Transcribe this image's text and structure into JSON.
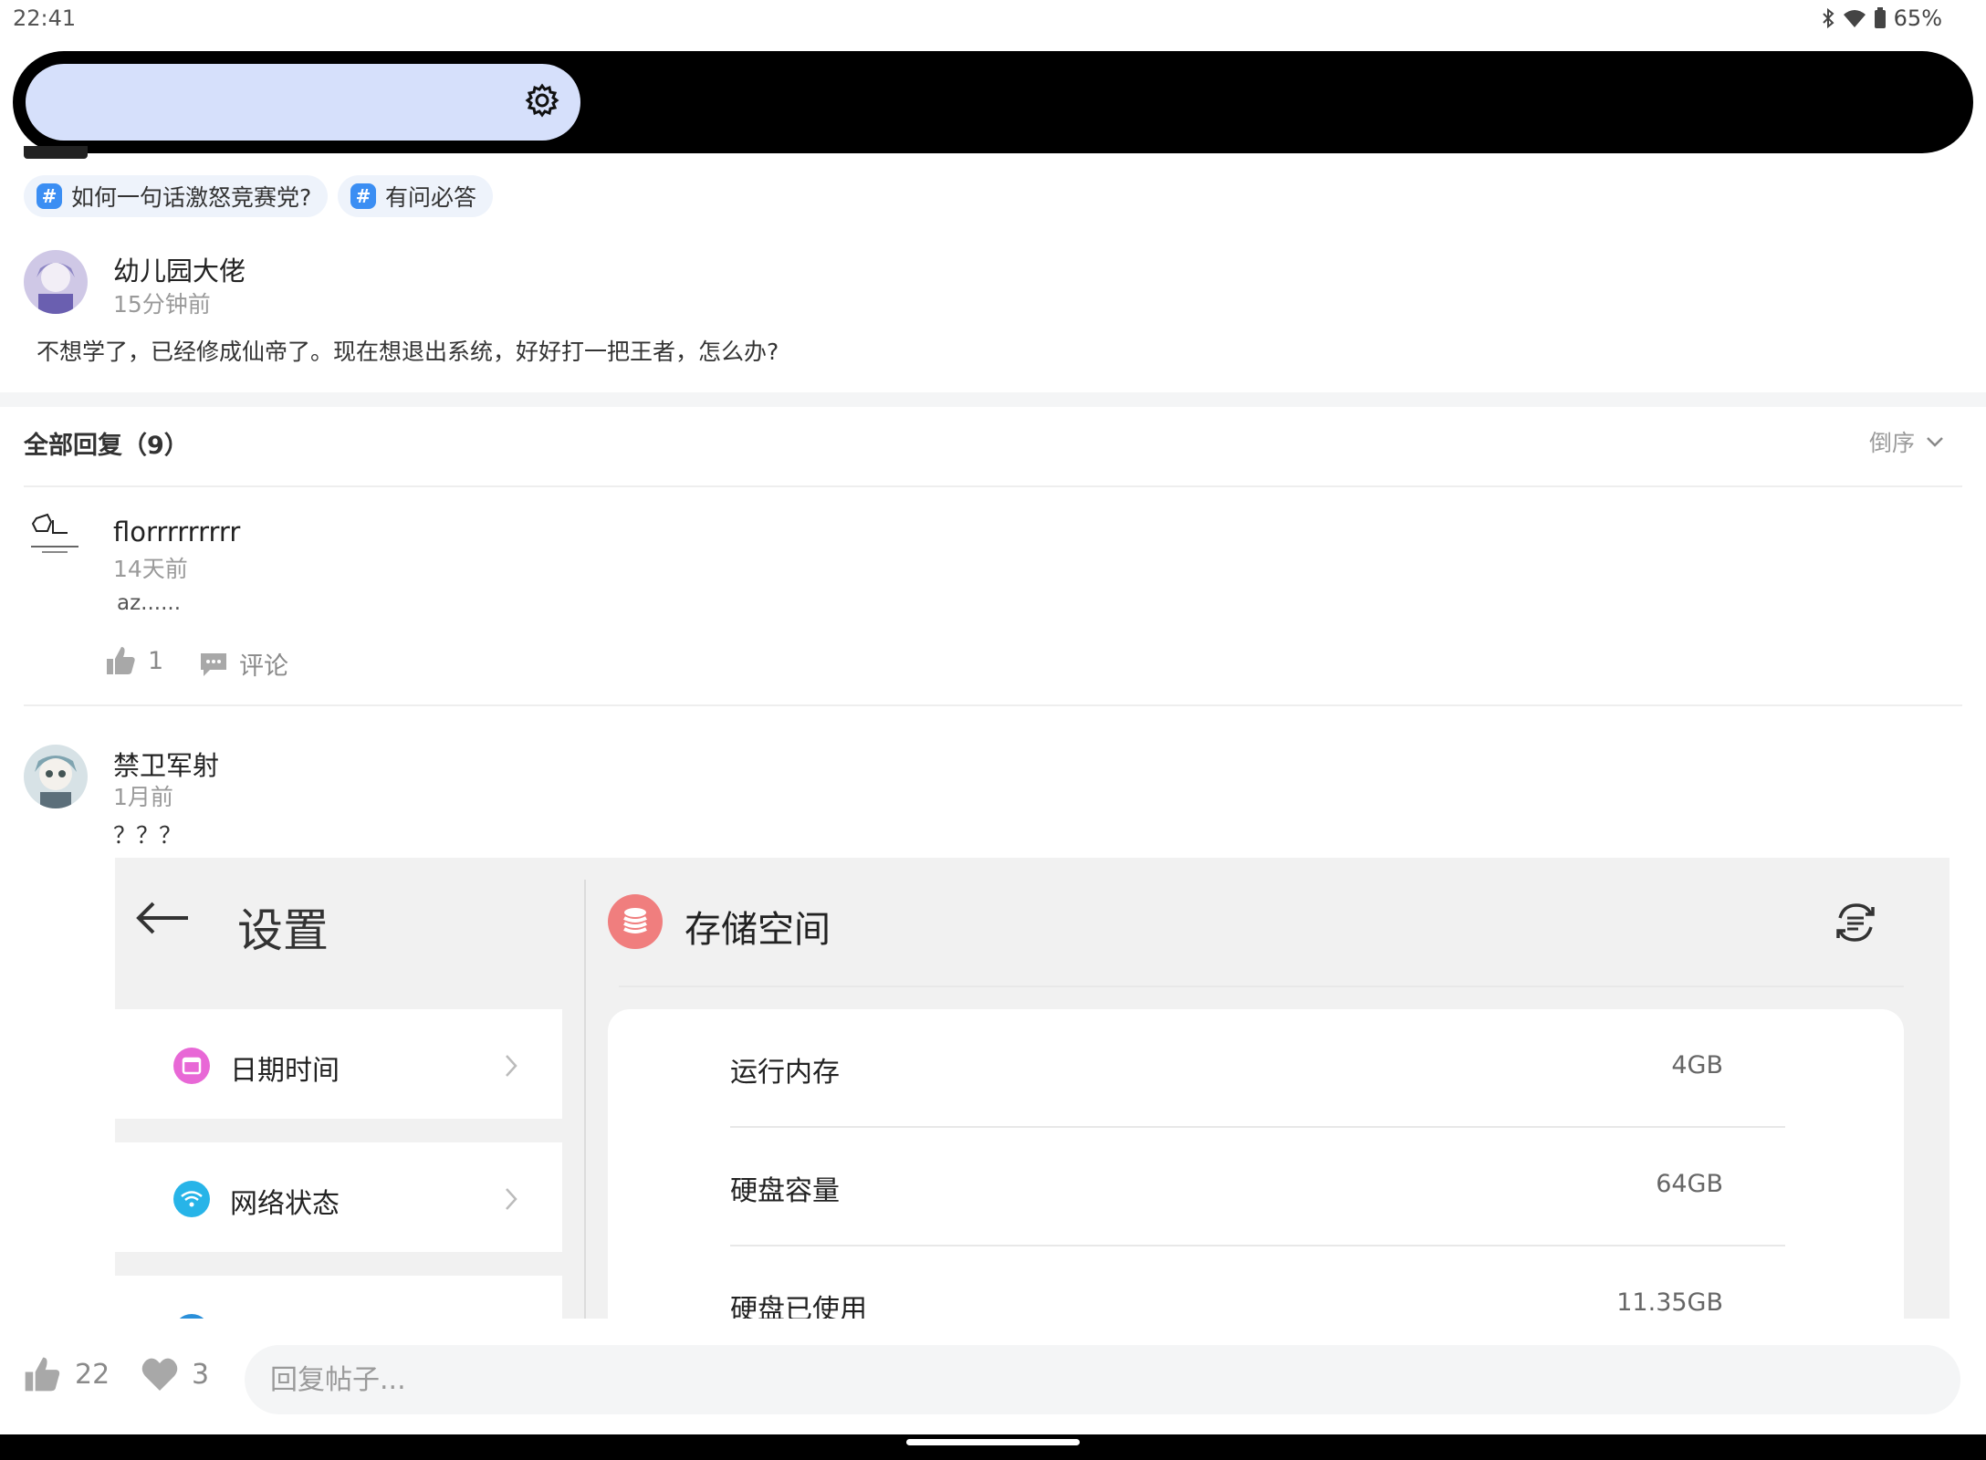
{
  "status_bar": {
    "time": "22:41",
    "battery": "65%"
  },
  "tags": [
    "如何一句话激怒竞赛党?",
    "有问必答"
  ],
  "post": {
    "author": "幼儿园大佬",
    "time": "15分钟前",
    "text": "不想学了，已经修成仙帝了。现在想退出系统，好好打一把王者，怎么办?"
  },
  "replies_header": {
    "title": "全部回复（9）",
    "sort_label": "倒序"
  },
  "replies": [
    {
      "author": "florrrrrrrrr",
      "time": "14天前",
      "text": "az......",
      "likes": "1",
      "comment_label": "评论"
    },
    {
      "author": "禁卫军射",
      "time": "1月前",
      "text": "？？？"
    }
  ],
  "embedded_screenshot": {
    "left_title": "设置",
    "menu_items": [
      {
        "label": "日期时间",
        "icon": "calendar-icon",
        "color": "#e868d6"
      },
      {
        "label": "网络状态",
        "icon": "wifi-icon",
        "color": "#27b4e8"
      }
    ],
    "right_title": "存储空间",
    "rows": [
      {
        "label": "运行内存",
        "value": "4GB"
      },
      {
        "label": "硬盘容量",
        "value": "64GB"
      },
      {
        "label": "硬盘已使用",
        "value": "11.35GB"
      }
    ]
  },
  "bottom_bar": {
    "likes": "22",
    "favorites": "3",
    "reply_placeholder": "回复帖子..."
  },
  "colors": {
    "accent": "#3b8ef3",
    "search_pill": "#d6e0fb",
    "storage_icon": "#f07e7e"
  }
}
